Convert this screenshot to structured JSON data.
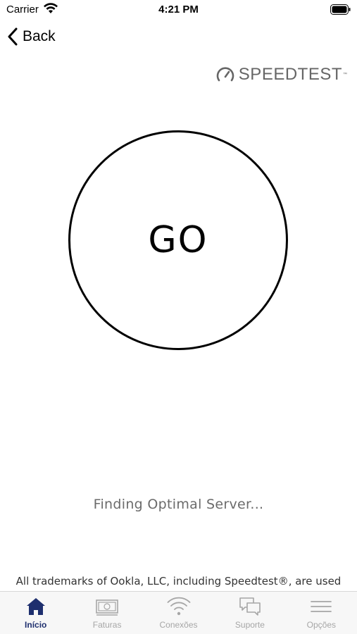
{
  "status_bar": {
    "carrier": "Carrier",
    "time": "4:21 PM"
  },
  "nav": {
    "back_label": "Back"
  },
  "logo": {
    "text": "SPEEDTEST",
    "tm": "™",
    "color": "#666666"
  },
  "go_button": {
    "label": "GO"
  },
  "status_text": "Finding Optimal Server...",
  "trademark_text": "All trademarks of Ookla, LLC, including Speedtest®, are used",
  "tab_bar": {
    "active_color": "#1e2f6e",
    "inactive_color": "#a6a6a6",
    "tabs": [
      {
        "label": "Início",
        "icon": "home-icon",
        "active": true
      },
      {
        "label": "Faturas",
        "icon": "invoice-icon",
        "active": false
      },
      {
        "label": "Conexões",
        "icon": "wifi-icon",
        "active": false
      },
      {
        "label": "Suporte",
        "icon": "chat-icon",
        "active": false
      },
      {
        "label": "Opções",
        "icon": "menu-icon",
        "active": false
      }
    ]
  }
}
